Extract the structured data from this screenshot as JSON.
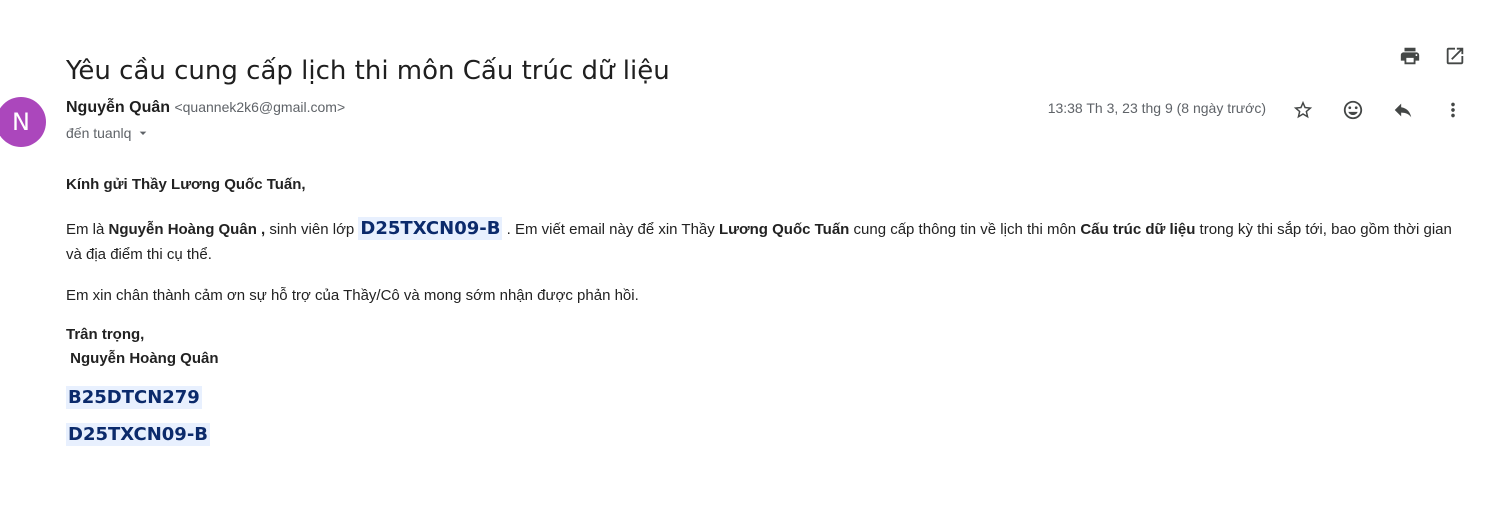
{
  "email": {
    "subject": "Yêu cầu cung cấp lịch thi môn Cấu trúc dữ liệu",
    "avatar_letter": "N",
    "sender_name": "Nguyễn Quân",
    "sender_email": "<quannek2k6@gmail.com>",
    "recipient": "đến tuanlq",
    "date": "13:38 Th 3, 23 thg 9 (8 ngày trước)"
  },
  "icons": {
    "print": "print-icon",
    "open_new": "open-in-new-window-icon",
    "star": "star-icon",
    "emoji": "emoji-reaction-icon",
    "reply": "reply-icon",
    "more": "more-vert-icon",
    "dropdown": "chevron-down-icon"
  },
  "body": {
    "greeting": "Kính gửi Thầy Lương Quốc Tuấn,",
    "p1_t1": "Em là ",
    "p1_name": "Nguyễn Hoàng Quân ,",
    "p1_t2": " sinh viên lớp ",
    "p1_class": "D25TXCN09-B",
    "p1_t3": " . Em viết email này để xin Thầy ",
    "p1_teacher": "Lương Quốc Tuấn",
    "p1_t4": " cung cấp thông tin về lịch thi môn ",
    "p1_subject": "Cấu trúc dữ liệu",
    "p1_t5": " trong kỳ thi sắp tới, bao gồm thời gian và địa điểm thi cụ thể.",
    "thanks": "Em xin chân thành cảm ơn sự hỗ trợ của Thầy/Cô và mong sớm nhận được phản hồi.",
    "regards": "Trân trọng,",
    "signature": "Nguyễn Hoàng Quân",
    "student_id": "B25DTCN279",
    "class_code": "D25TXCN09-B"
  },
  "colors": {
    "avatar_bg": "#ab47bc",
    "highlight_bg": "#e8f0fe",
    "highlight_text": "#0b2a6b"
  }
}
